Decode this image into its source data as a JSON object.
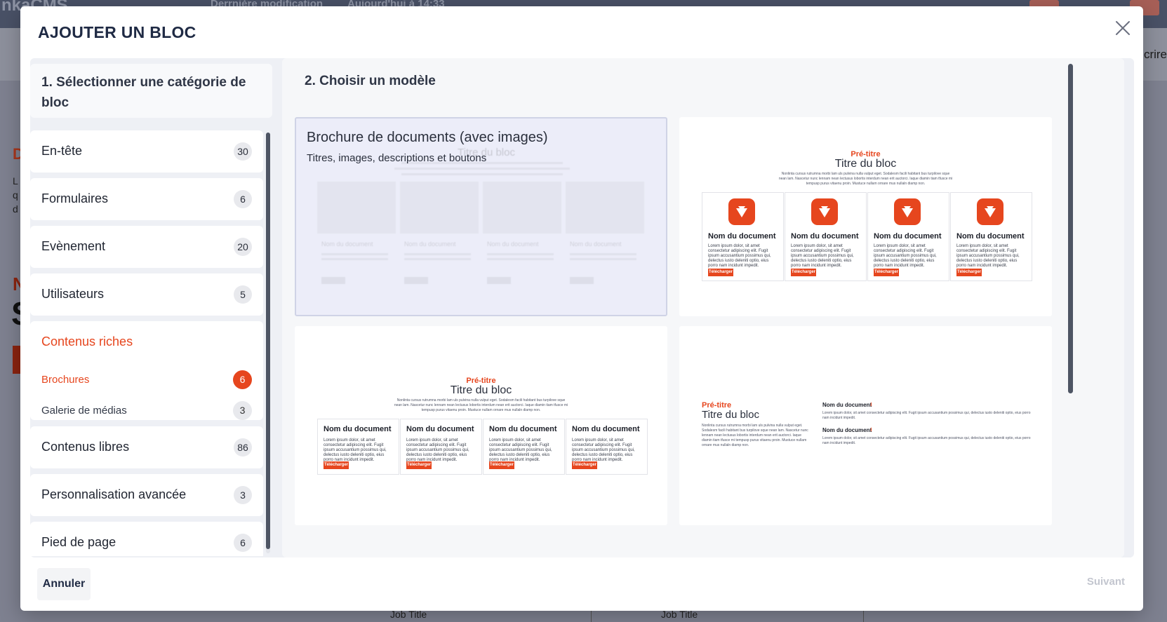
{
  "background": {
    "app_name": "nkaCMS",
    "tabs": [
      "Derrnière modification",
      "Aujourd'hui à 14:33"
    ],
    "right_text": "crire",
    "left_letters": [
      "D",
      "N",
      "S"
    ],
    "left_lines": [
      "L",
      "q",
      "d"
    ],
    "bottom_cells": [
      "Job Title",
      "Job Title"
    ]
  },
  "modal": {
    "title": "AJOUTER UN BLOC",
    "close_icon": "close-icon",
    "step1_label": "1. Sélectionner une catégorie de bloc",
    "step2_label": "2. Choisir un modèle",
    "categories": [
      {
        "label": "En-tête",
        "count": "30"
      },
      {
        "label": "Formulaires",
        "count": "6"
      },
      {
        "label": "Evènement",
        "count": "20"
      },
      {
        "label": "Utilisateurs",
        "count": "5"
      }
    ],
    "open_category": {
      "label": "Contenus riches",
      "subcategories": [
        {
          "label": "Brochures",
          "count": "6",
          "active": true
        },
        {
          "label": "Galerie de médias",
          "count": "3",
          "active": false
        }
      ]
    },
    "categories_after": [
      {
        "label": "Contenus libres",
        "count": "86"
      },
      {
        "label": "Personnalisation avancée",
        "count": "3"
      },
      {
        "label": "Pied de page",
        "count": "6"
      }
    ],
    "templates": {
      "hovered": {
        "title": "Brochure de documents (avec images)",
        "subtitle": "Titres, images, descriptions et boutons",
        "ghost_title": "Titre du bloc",
        "ghost_doc": "Nom du document"
      },
      "preview": {
        "pre_title": "Pré-titre",
        "block_title": "Titre du bloc",
        "intro": "Nonlinta cursus rutrumna morbi lam uls pulvina nulla vulput eget. Sodalesm facili habitant bus turpilove sque nean lam. Nascetur nunc lennam nean lectusus lobortis interdum nean erit auctorci. Iaque diamin tiam tfusce mi tempusp purus vitaenu proin. Mustuce nullam ornare mus nullaln diamp non.",
        "doc_name": "Nom du document",
        "doc_text": "Lorem ipsum dolor, sit amet consectetur adipiscing elit. Fugit ipsum accusantium possimus qui, delectus iusto deleniti optio, eius porro nam incidunt impedit.",
        "button": "Télécharger"
      }
    },
    "cancel_label": "Annuler",
    "next_label": "Suivant",
    "accent_color": "#e6461e"
  }
}
